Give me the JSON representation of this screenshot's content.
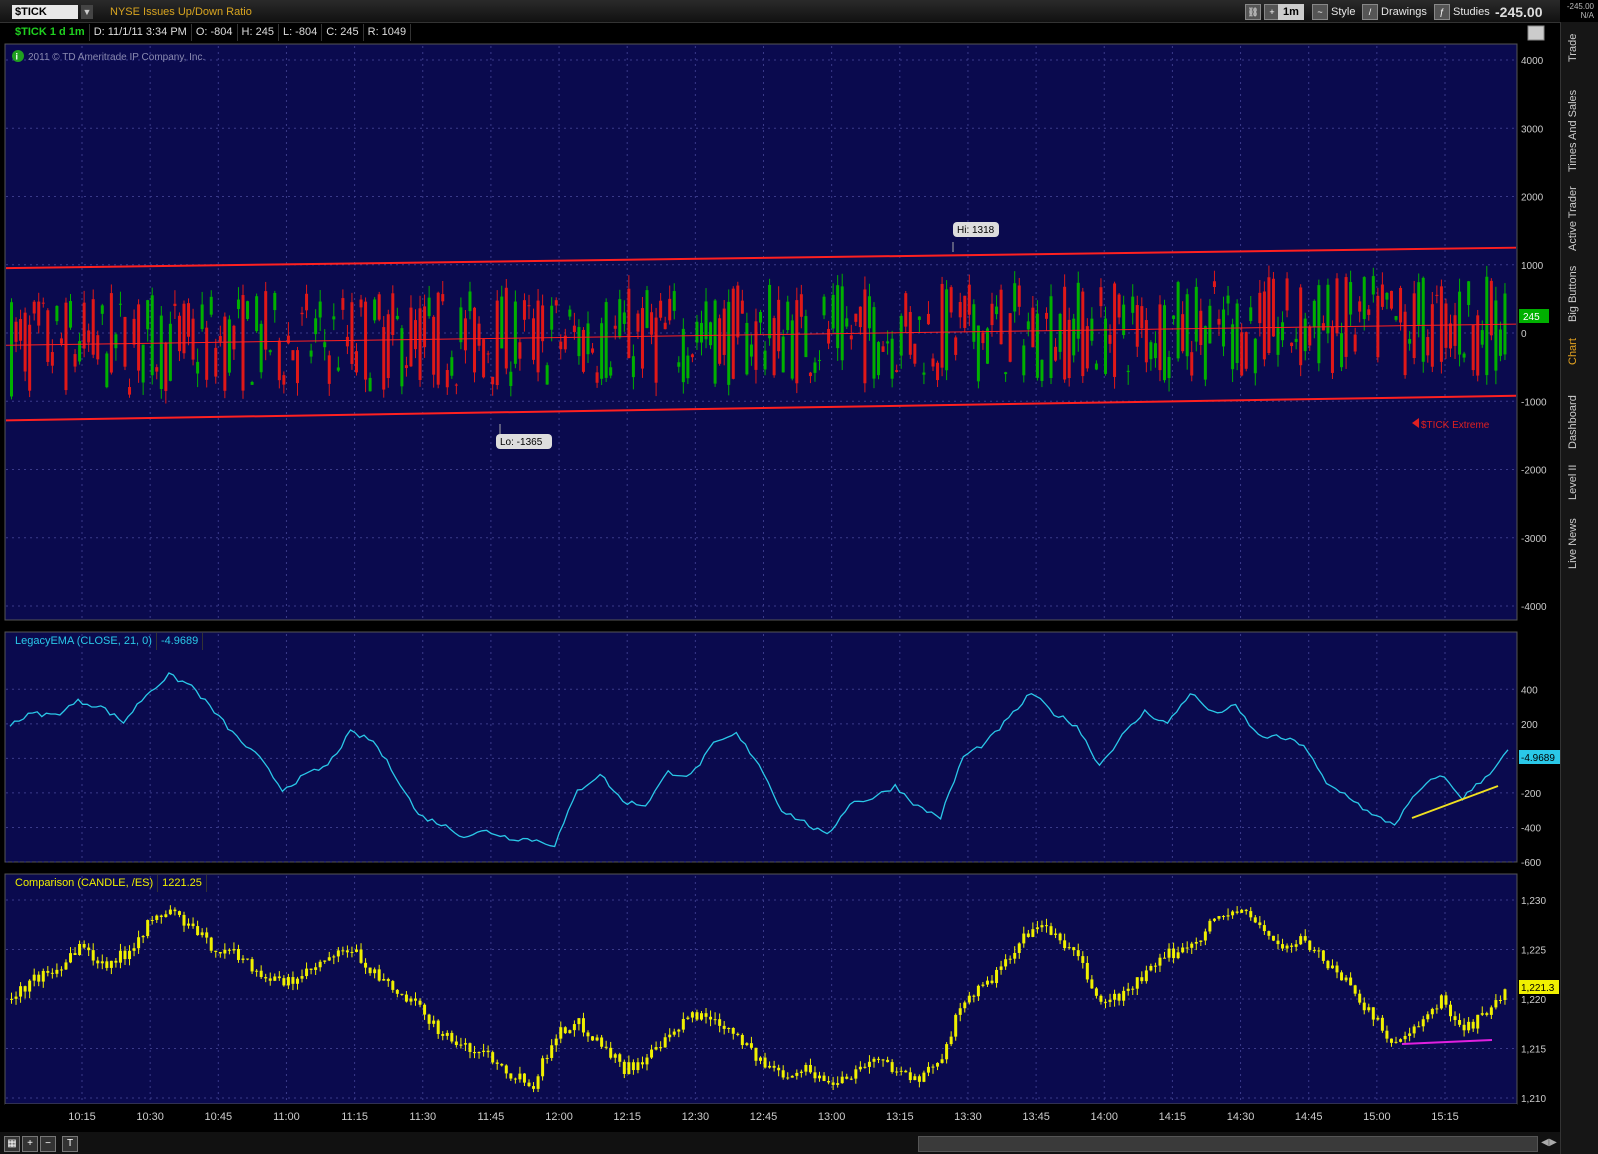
{
  "header": {
    "symbol": "$TICK",
    "description": "NYSE Issues Up/Down Ratio",
    "timeframe_btn": "1m",
    "style_label": "Style",
    "drawings_label": "Drawings",
    "studies_label": "Studies",
    "last_price": "-245.00",
    "mini_price": "-245.00",
    "mini_na": "N/A"
  },
  "right_tabs": [
    "Trade",
    "Times And Sales",
    "Active Trader",
    "Big Buttons",
    "Chart",
    "Dashboard",
    "Level II",
    "Live News"
  ],
  "active_tab": "Chart",
  "main_legend": {
    "title": "$TICK 1 d 1m",
    "date": "D: 11/1/11 3:34 PM",
    "open": "O: -804",
    "high": "H: 245",
    "low": "L: -804",
    "close": "C: 245",
    "range": "R: 1049"
  },
  "copyright": "2011 © TD Ameritrade IP Company, Inc.",
  "hi_label": "Hi: 1318",
  "lo_label": "Lo: -1365",
  "extreme_label": "$TICK Extreme",
  "main_price_tag": "245",
  "ema_legend": {
    "name": "LegacyEMA (CLOSE, 21, 0)",
    "value": "-4.9689"
  },
  "ema_price_tag": "-4.9689",
  "cmp_legend": {
    "name": "Comparison (CANDLE, /ES)",
    "value": "1221.25"
  },
  "cmp_price_tag": "1,221.3",
  "colors": {
    "bg": "#0a0a4e",
    "up": "#00b000",
    "down": "#e01818",
    "ema": "#2ac8e8",
    "es": "#f0f000",
    "channel": "#ff2020",
    "grid": "#3a3a8a"
  },
  "chart_data": [
    {
      "type": "candlestick",
      "title": "$TICK 1 d 1m",
      "y_ticks": [
        "4000",
        "3000",
        "2000",
        "1000",
        "0",
        "-1000",
        "-2000",
        "-3000",
        "-4000"
      ],
      "ylim": [
        -4000,
        4000
      ],
      "hi": 1318,
      "lo": -1365,
      "channel_upper": [
        950,
        1250
      ],
      "channel_lower": [
        -1280,
        -920
      ],
      "channel_mid": [
        -180,
        130
      ]
    },
    {
      "type": "line",
      "title": "LegacyEMA (CLOSE, 21, 0)",
      "y_ticks": [
        "400",
        "200",
        "0",
        "-200",
        "-400",
        "-600"
      ],
      "ylim": [
        -600,
        500
      ],
      "x": [
        "10:05",
        "10:10",
        "10:15",
        "10:20",
        "10:25",
        "10:30",
        "10:35",
        "10:40",
        "10:45",
        "10:50",
        "10:55",
        "11:00",
        "11:05",
        "11:10",
        "11:15",
        "11:20",
        "11:25",
        "11:30",
        "11:35",
        "11:40",
        "11:45",
        "11:50",
        "11:55",
        "12:00",
        "12:05",
        "12:10",
        "12:15",
        "12:20",
        "12:25",
        "12:30",
        "12:35",
        "12:40",
        "12:45",
        "12:50",
        "12:55",
        "13:00",
        "13:05",
        "13:10",
        "13:15",
        "13:20",
        "13:25",
        "13:30",
        "13:35",
        "13:40",
        "13:45",
        "13:50",
        "13:55",
        "14:00",
        "14:05",
        "14:10",
        "14:15",
        "14:20",
        "14:25",
        "14:30",
        "14:35",
        "14:40",
        "14:45",
        "14:50",
        "14:55",
        "15:00",
        "15:05",
        "15:10",
        "15:15",
        "15:20",
        "15:25",
        "15:30",
        "15:34"
      ],
      "values": [
        200,
        260,
        250,
        330,
        300,
        210,
        370,
        480,
        420,
        270,
        120,
        0,
        -180,
        -100,
        -40,
        150,
        100,
        -100,
        -330,
        -380,
        -450,
        -420,
        -460,
        -470,
        -500,
        -190,
        -90,
        -250,
        -270,
        -80,
        -100,
        80,
        140,
        -30,
        -300,
        -370,
        -450,
        -260,
        -230,
        -160,
        -280,
        -340,
        10,
        90,
        230,
        380,
        260,
        190,
        -40,
        130,
        270,
        200,
        380,
        260,
        300,
        130,
        120,
        80,
        -150,
        -220,
        -330,
        -380,
        -200,
        -90,
        -230,
        -110,
        40
      ]
    },
    {
      "type": "candlestick",
      "title": "Comparison (CANDLE, /ES)",
      "y_ticks": [
        "1,230",
        "1,225",
        "1,220",
        "1,215",
        "1,210"
      ],
      "ylim": [
        1210,
        1230
      ],
      "x_ticks": [
        "10:15",
        "10:30",
        "10:45",
        "11:00",
        "11:15",
        "11:30",
        "11:45",
        "12:00",
        "12:15",
        "12:30",
        "12:45",
        "13:00",
        "13:15",
        "13:30",
        "13:45",
        "14:00",
        "14:15",
        "14:30",
        "14:45",
        "15:00",
        "15:15"
      ],
      "closes": [
        1220.0,
        1222.0,
        1223.0,
        1225.5,
        1223.5,
        1224.5,
        1227.5,
        1229.0,
        1227.0,
        1225.0,
        1224.5,
        1222.5,
        1221.5,
        1222.5,
        1224.0,
        1225.0,
        1222.5,
        1220.5,
        1219.0,
        1216.5,
        1215.0,
        1214.5,
        1212.5,
        1211.5,
        1216.5,
        1217.5,
        1215.5,
        1213.0,
        1214.0,
        1216.0,
        1218.5,
        1218.0,
        1216.5,
        1213.5,
        1212.5,
        1213.0,
        1211.5,
        1212.5,
        1214.0,
        1213.0,
        1211.5,
        1214.5,
        1220.0,
        1221.5,
        1224.0,
        1227.5,
        1226.5,
        1224.0,
        1219.5,
        1220.5,
        1222.5,
        1224.5,
        1225.5,
        1228.0,
        1229.0,
        1227.5,
        1225.0,
        1226.0,
        1223.5,
        1221.5,
        1218.0,
        1215.5,
        1217.0,
        1220.0,
        1217.0,
        1218.5,
        1221.0
      ]
    }
  ]
}
